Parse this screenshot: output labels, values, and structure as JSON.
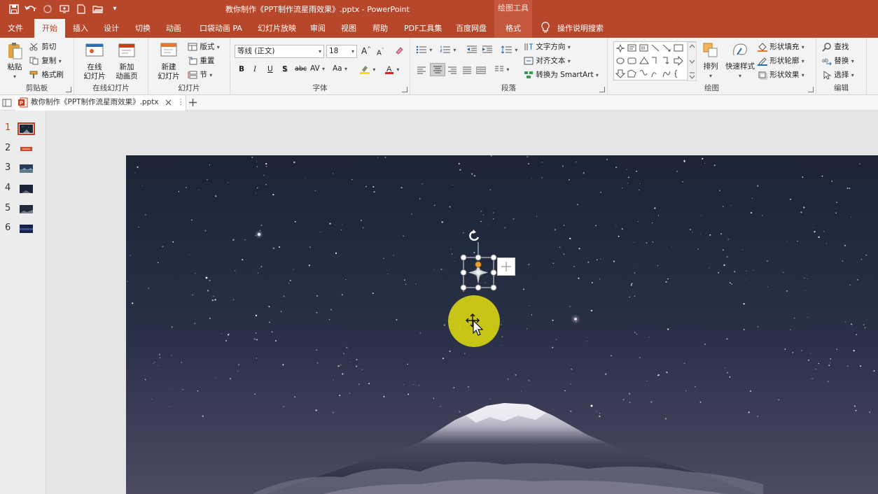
{
  "window": {
    "doc_title": "教你制作《PPT制作流星雨效果》.pptx  -  PowerPoint",
    "context_group": "绘图工具"
  },
  "tabs": [
    {
      "label": "文件"
    },
    {
      "label": "开始"
    },
    {
      "label": "插入"
    },
    {
      "label": "设计"
    },
    {
      "label": "切换"
    },
    {
      "label": "动画"
    },
    {
      "label": "口袋动画 PA"
    },
    {
      "label": "幻灯片放映"
    },
    {
      "label": "审阅"
    },
    {
      "label": "视图"
    },
    {
      "label": "帮助"
    },
    {
      "label": "PDF工具集"
    },
    {
      "label": "百度网盘"
    },
    {
      "label": "格式"
    }
  ],
  "tell_me": "操作说明搜索",
  "ribbon": {
    "clipboard": {
      "paste": "粘贴",
      "cut": "剪切",
      "copy": "复制",
      "format_painter": "格式刷",
      "label": "剪贴板"
    },
    "online_slides": {
      "online": "在线\n幻灯片",
      "new_anim": "新加\n动画页",
      "label": "在线幻灯片"
    },
    "slides": {
      "new_slide": "新建\n幻灯片",
      "layout": "版式",
      "reset": "重置",
      "section": "节",
      "label": "幻灯片"
    },
    "font": {
      "font_name": "等线 (正文)",
      "font_size": "18",
      "label": "字体",
      "bold": "B",
      "italic": "I",
      "underline": "U",
      "shadow": "S",
      "strike": "abc",
      "spacing": "AV",
      "case": "Aa",
      "grow": "A",
      "shrink": "A"
    },
    "paragraph": {
      "text_direction": "文字方向",
      "align_text": "对齐文本",
      "smartart": "转换为 SmartArt",
      "label": "段落"
    },
    "drawing": {
      "arrange": "排列",
      "quick_styles": "快速样式",
      "fill": "形状填充",
      "outline": "形状轮廓",
      "effects": "形状效果",
      "label": "绘图"
    },
    "editing": {
      "find": "查找",
      "replace": "替换",
      "select": "选择",
      "label": "编辑"
    }
  },
  "doc_tab": {
    "label": "教你制作《PPT制作流星雨效果》.pptx"
  },
  "thumbnails": [
    {
      "num": "1",
      "active": true
    },
    {
      "num": "2",
      "active": false
    },
    {
      "num": "3",
      "active": false
    },
    {
      "num": "4",
      "active": false
    },
    {
      "num": "5",
      "active": false
    },
    {
      "num": "6",
      "active": false
    }
  ],
  "colors": {
    "accent": "#b7472a",
    "active_tab_text": "#b7472a",
    "cursor_highlight": "#d5d214"
  }
}
